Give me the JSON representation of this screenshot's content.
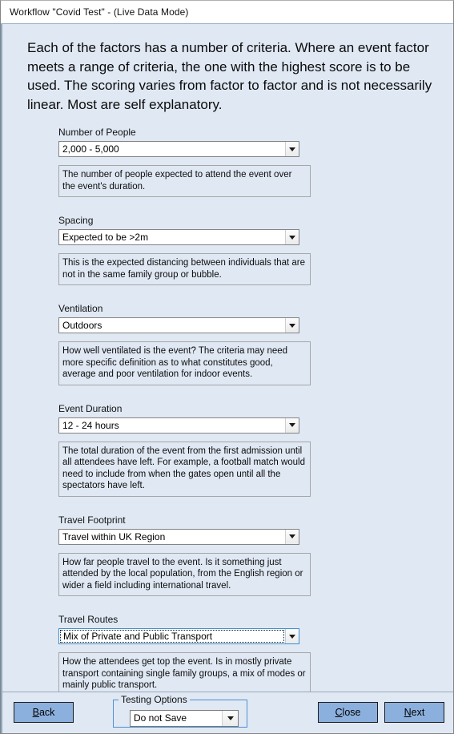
{
  "window": {
    "title": "Workflow \"Covid Test\" - (Live Data Mode)"
  },
  "colors": {
    "body_background": "#dfe8f3",
    "button_face": "#8cb0de",
    "focus_border": "#3c8fd0",
    "groupbox_border": "#4f8fd0",
    "field_border": "#848484"
  },
  "intro": {
    "text": "Each of the factors has a number of criteria. Where an event factor meets a range of criteria, the one with the highest score is to be used. The scoring varies from factor to factor and is not necessarily linear. Most are self explanatory."
  },
  "fields": [
    {
      "label": "Number of People",
      "value": "2,000 - 5,000",
      "description": "The number of people expected to attend the event over the event's duration.",
      "focused": false
    },
    {
      "label": "Spacing",
      "value": "Expected to be >2m",
      "description": "This is the expected distancing between individuals that are not in the same family group or bubble.",
      "focused": false
    },
    {
      "label": "Ventilation",
      "value": "Outdoors",
      "description": "How well ventilated is the event? The criteria may need more specific definition as to what constitutes good, average and poor ventilation for indoor events.",
      "focused": false
    },
    {
      "label": "Event Duration",
      "value": "12 - 24 hours",
      "description": "The total duration of the event from the first admission until all attendees have left. For example, a football match would need to include from when the gates open until all the spectators have left.",
      "focused": false
    },
    {
      "label": "Travel Footprint",
      "value": "Travel within UK Region",
      "description": "How far people travel to the event. Is it something just attended by the local population, from the English region or wider a field including international travel.",
      "focused": false
    },
    {
      "label": "Travel Routes",
      "value": "Mix of Private and Public Transport",
      "description": "How the attendees get top the event. Is in mostly private transport containing single family groups, a mix of modes or mainly public transport.",
      "focused": true
    }
  ],
  "footer": {
    "back_label": "Back",
    "back_accel": "B",
    "back_rest": "ack",
    "close_label": "Close",
    "close_accel": "C",
    "close_rest": "lose",
    "next_label": "Next",
    "next_accel": "N",
    "next_rest": "ext",
    "testing_options": {
      "group_label": "Testing Options",
      "value": "Do not Save"
    }
  },
  "icons": {
    "dropdown_arrow": "chevron-down-icon"
  }
}
